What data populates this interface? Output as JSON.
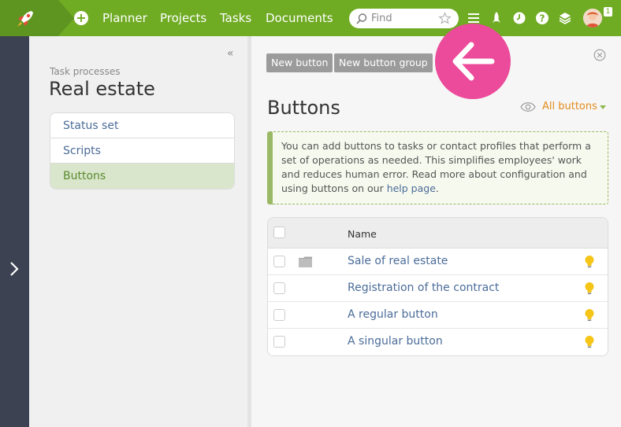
{
  "topbar": {
    "nav": [
      "Planner",
      "Projects",
      "Tasks",
      "Documents"
    ],
    "search_placeholder": "Find",
    "notification_count": "1"
  },
  "sidebar": {
    "subtitle": "Task processes",
    "title": "Real estate",
    "items": [
      {
        "label": "Status set"
      },
      {
        "label": "Scripts"
      },
      {
        "label": "Buttons"
      }
    ]
  },
  "main": {
    "new_button_label": "New button",
    "new_group_label": "New button group",
    "title": "Buttons",
    "filter_label": "All buttons",
    "info_text": "You can add buttons to tasks or contact profiles that perform a set of operations as needed. This simplifies employees' work and reduces human error. Read more about configuration and using buttons on our ",
    "info_link": "help page",
    "info_end": ".",
    "table": {
      "header_name": "Name",
      "rows": [
        {
          "name": "Sale of real estate"
        },
        {
          "name": "Registration of the contract"
        },
        {
          "name": "A regular button"
        },
        {
          "name": "A singular button"
        }
      ]
    }
  },
  "colors": {
    "brand_green": "#70ab24",
    "link_blue": "#4b6c99",
    "accent_orange": "#e38b1b",
    "overlay_pink": "#ec4a9a"
  }
}
